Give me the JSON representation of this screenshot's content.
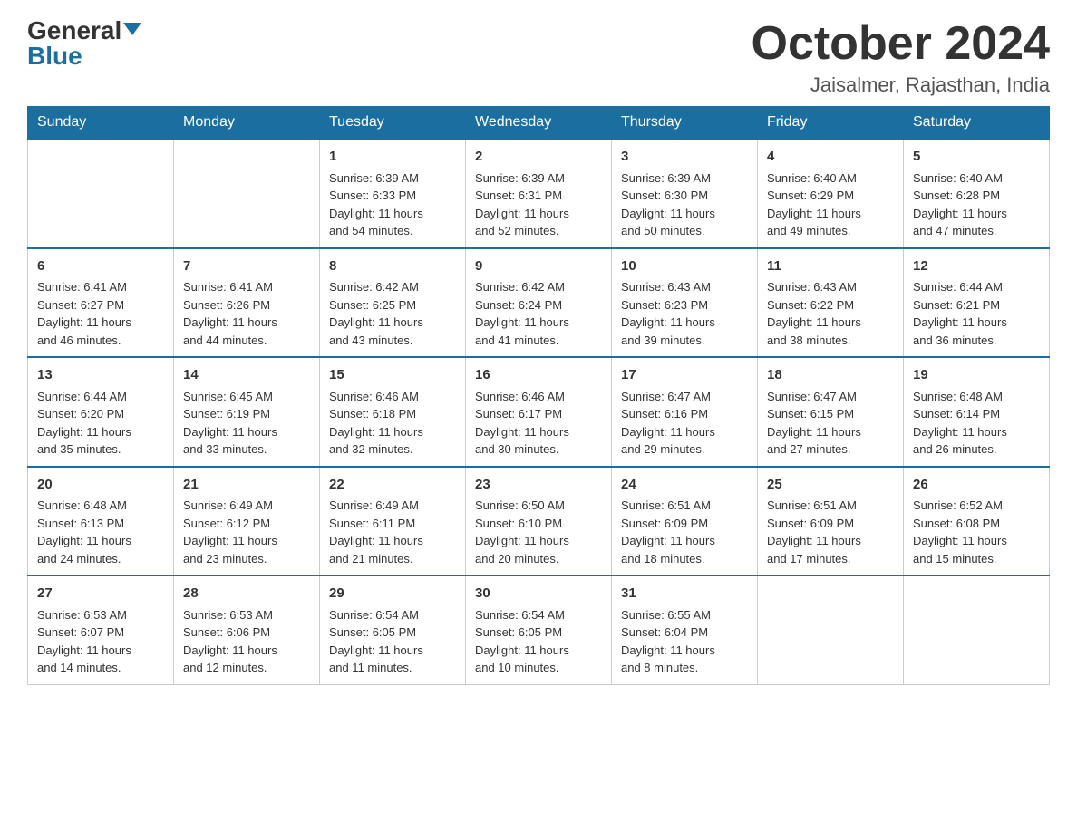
{
  "logo": {
    "general": "General",
    "blue": "Blue"
  },
  "header": {
    "month": "October 2024",
    "location": "Jaisalmer, Rajasthan, India"
  },
  "days_of_week": [
    "Sunday",
    "Monday",
    "Tuesday",
    "Wednesday",
    "Thursday",
    "Friday",
    "Saturday"
  ],
  "weeks": [
    [
      {
        "day": "",
        "info": ""
      },
      {
        "day": "",
        "info": ""
      },
      {
        "day": "1",
        "info": "Sunrise: 6:39 AM\nSunset: 6:33 PM\nDaylight: 11 hours\nand 54 minutes."
      },
      {
        "day": "2",
        "info": "Sunrise: 6:39 AM\nSunset: 6:31 PM\nDaylight: 11 hours\nand 52 minutes."
      },
      {
        "day": "3",
        "info": "Sunrise: 6:39 AM\nSunset: 6:30 PM\nDaylight: 11 hours\nand 50 minutes."
      },
      {
        "day": "4",
        "info": "Sunrise: 6:40 AM\nSunset: 6:29 PM\nDaylight: 11 hours\nand 49 minutes."
      },
      {
        "day": "5",
        "info": "Sunrise: 6:40 AM\nSunset: 6:28 PM\nDaylight: 11 hours\nand 47 minutes."
      }
    ],
    [
      {
        "day": "6",
        "info": "Sunrise: 6:41 AM\nSunset: 6:27 PM\nDaylight: 11 hours\nand 46 minutes."
      },
      {
        "day": "7",
        "info": "Sunrise: 6:41 AM\nSunset: 6:26 PM\nDaylight: 11 hours\nand 44 minutes."
      },
      {
        "day": "8",
        "info": "Sunrise: 6:42 AM\nSunset: 6:25 PM\nDaylight: 11 hours\nand 43 minutes."
      },
      {
        "day": "9",
        "info": "Sunrise: 6:42 AM\nSunset: 6:24 PM\nDaylight: 11 hours\nand 41 minutes."
      },
      {
        "day": "10",
        "info": "Sunrise: 6:43 AM\nSunset: 6:23 PM\nDaylight: 11 hours\nand 39 minutes."
      },
      {
        "day": "11",
        "info": "Sunrise: 6:43 AM\nSunset: 6:22 PM\nDaylight: 11 hours\nand 38 minutes."
      },
      {
        "day": "12",
        "info": "Sunrise: 6:44 AM\nSunset: 6:21 PM\nDaylight: 11 hours\nand 36 minutes."
      }
    ],
    [
      {
        "day": "13",
        "info": "Sunrise: 6:44 AM\nSunset: 6:20 PM\nDaylight: 11 hours\nand 35 minutes."
      },
      {
        "day": "14",
        "info": "Sunrise: 6:45 AM\nSunset: 6:19 PM\nDaylight: 11 hours\nand 33 minutes."
      },
      {
        "day": "15",
        "info": "Sunrise: 6:46 AM\nSunset: 6:18 PM\nDaylight: 11 hours\nand 32 minutes."
      },
      {
        "day": "16",
        "info": "Sunrise: 6:46 AM\nSunset: 6:17 PM\nDaylight: 11 hours\nand 30 minutes."
      },
      {
        "day": "17",
        "info": "Sunrise: 6:47 AM\nSunset: 6:16 PM\nDaylight: 11 hours\nand 29 minutes."
      },
      {
        "day": "18",
        "info": "Sunrise: 6:47 AM\nSunset: 6:15 PM\nDaylight: 11 hours\nand 27 minutes."
      },
      {
        "day": "19",
        "info": "Sunrise: 6:48 AM\nSunset: 6:14 PM\nDaylight: 11 hours\nand 26 minutes."
      }
    ],
    [
      {
        "day": "20",
        "info": "Sunrise: 6:48 AM\nSunset: 6:13 PM\nDaylight: 11 hours\nand 24 minutes."
      },
      {
        "day": "21",
        "info": "Sunrise: 6:49 AM\nSunset: 6:12 PM\nDaylight: 11 hours\nand 23 minutes."
      },
      {
        "day": "22",
        "info": "Sunrise: 6:49 AM\nSunset: 6:11 PM\nDaylight: 11 hours\nand 21 minutes."
      },
      {
        "day": "23",
        "info": "Sunrise: 6:50 AM\nSunset: 6:10 PM\nDaylight: 11 hours\nand 20 minutes."
      },
      {
        "day": "24",
        "info": "Sunrise: 6:51 AM\nSunset: 6:09 PM\nDaylight: 11 hours\nand 18 minutes."
      },
      {
        "day": "25",
        "info": "Sunrise: 6:51 AM\nSunset: 6:09 PM\nDaylight: 11 hours\nand 17 minutes."
      },
      {
        "day": "26",
        "info": "Sunrise: 6:52 AM\nSunset: 6:08 PM\nDaylight: 11 hours\nand 15 minutes."
      }
    ],
    [
      {
        "day": "27",
        "info": "Sunrise: 6:53 AM\nSunset: 6:07 PM\nDaylight: 11 hours\nand 14 minutes."
      },
      {
        "day": "28",
        "info": "Sunrise: 6:53 AM\nSunset: 6:06 PM\nDaylight: 11 hours\nand 12 minutes."
      },
      {
        "day": "29",
        "info": "Sunrise: 6:54 AM\nSunset: 6:05 PM\nDaylight: 11 hours\nand 11 minutes."
      },
      {
        "day": "30",
        "info": "Sunrise: 6:54 AM\nSunset: 6:05 PM\nDaylight: 11 hours\nand 10 minutes."
      },
      {
        "day": "31",
        "info": "Sunrise: 6:55 AM\nSunset: 6:04 PM\nDaylight: 11 hours\nand 8 minutes."
      },
      {
        "day": "",
        "info": ""
      },
      {
        "day": "",
        "info": ""
      }
    ]
  ]
}
